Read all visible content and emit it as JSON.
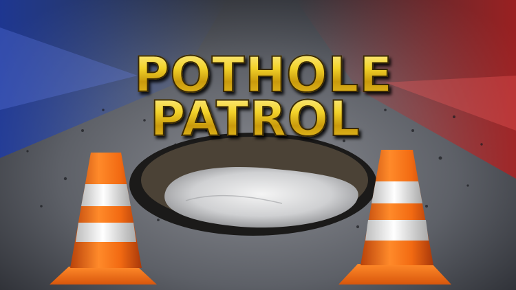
{
  "title": {
    "line1": "POTHOLE",
    "line2": "PATROL"
  },
  "colors": {
    "title_gold": "#e9c31a",
    "cone_orange": "#f26a12",
    "cone_stripe": "#f2f2f2",
    "siren_blue": "#2a4fb8",
    "siren_red": "#c22b2b",
    "asphalt": "#4a4c52"
  },
  "icons": [
    "traffic-cone-icon",
    "traffic-cone-icon"
  ]
}
